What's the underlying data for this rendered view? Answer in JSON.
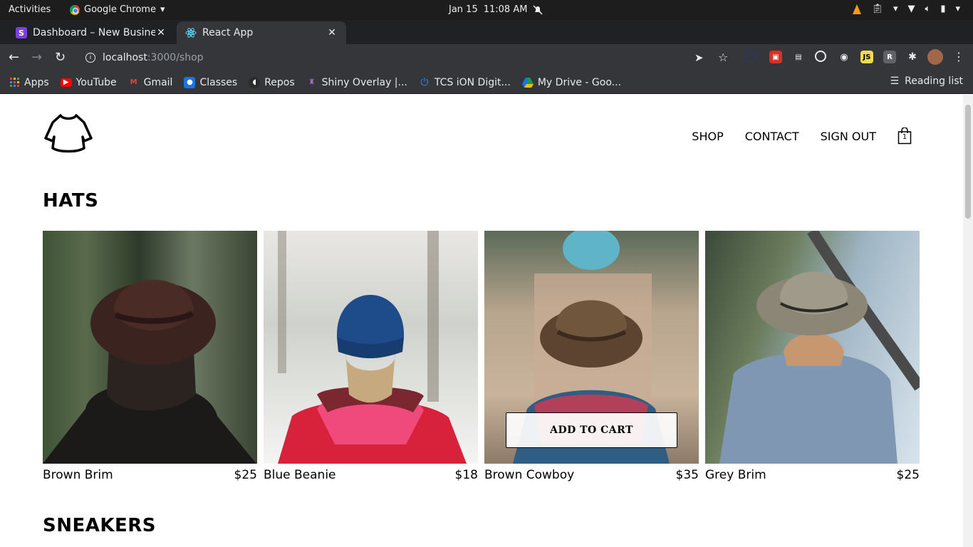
{
  "system_bar": {
    "activities": "Activities",
    "app_name": "Google Chrome",
    "date": "Jan 15",
    "time": "11:08 AM"
  },
  "tabs": [
    {
      "title": "Dashboard – New Busines",
      "favicon_letter": "S",
      "favicon_color": "#7b3fe4"
    },
    {
      "title": "React App",
      "favicon_color": "#61dafb"
    }
  ],
  "omnibox": {
    "host": "localhost",
    "path": ":3000/shop"
  },
  "bookmarks": {
    "items": [
      {
        "label": "Apps",
        "icon": "apps-grid-icon"
      },
      {
        "label": "YouTube",
        "icon": "youtube-icon",
        "color": "#ff0000"
      },
      {
        "label": "Gmail",
        "icon": "gmail-icon",
        "color": "#ea4335"
      },
      {
        "label": "Classes",
        "icon": "classroom-icon",
        "color": "#1a73e8"
      },
      {
        "label": "Repos",
        "icon": "github-icon",
        "color": "#444"
      },
      {
        "label": "Shiny Overlay |...",
        "icon": "shiny-icon",
        "color": "#8e44ad"
      },
      {
        "label": "TCS iON Digit...",
        "icon": "power-icon",
        "color": "#1a73e8"
      },
      {
        "label": "My Drive - Goo...",
        "icon": "drive-icon",
        "color": "#0f9d58"
      }
    ],
    "reading_list": "Reading list"
  },
  "shop": {
    "nav": {
      "shop": "SHOP",
      "contact": "CONTACT",
      "sign_out": "SIGN OUT",
      "cart_count": "1"
    },
    "sections": [
      {
        "title": "HATS",
        "items": [
          {
            "name": "Brown Brim",
            "price": "$25"
          },
          {
            "name": "Blue Beanie",
            "price": "$18"
          },
          {
            "name": "Brown Cowboy",
            "price": "$35"
          },
          {
            "name": "Grey Brim",
            "price": "$25"
          }
        ]
      },
      {
        "title": "SNEAKERS"
      }
    ],
    "add_to_cart": "ADD TO CART"
  }
}
